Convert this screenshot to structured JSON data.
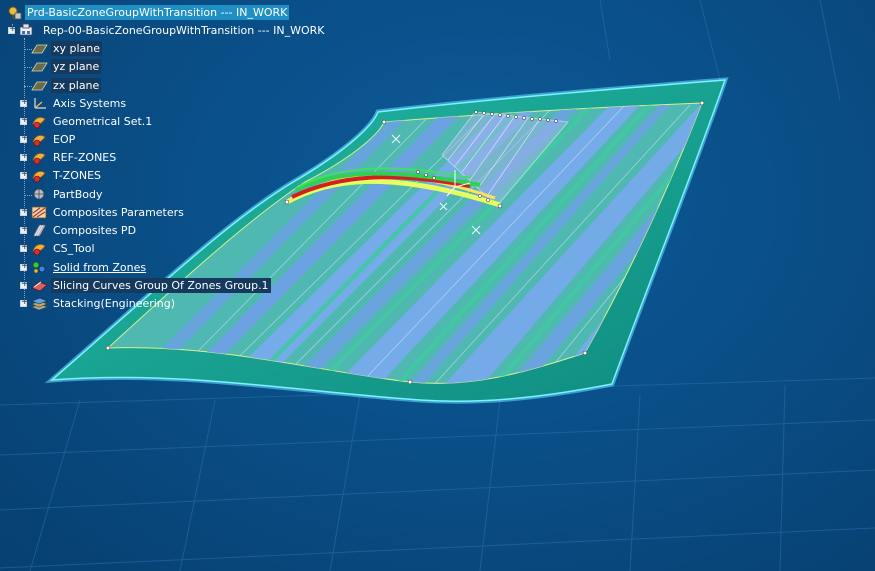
{
  "tree": {
    "root_label": "Prd-BasicZoneGroupWithTransition --- IN_WORK",
    "rep_label": "Rep-00-BasicZoneGroupWithTransition --- IN_WORK",
    "planes": [
      "xy plane",
      "yz plane",
      "zx plane"
    ],
    "items": [
      {
        "label": "Axis Systems",
        "icon": "axis-icon"
      },
      {
        "label": "Geometrical Set.1",
        "icon": "geometrical-set-icon"
      },
      {
        "label": "EOP",
        "icon": "geometrical-set-icon"
      },
      {
        "label": "REF-ZONES",
        "icon": "geometrical-set-icon"
      },
      {
        "label": "T-ZONES",
        "icon": "geometrical-set-icon"
      },
      {
        "label": "PartBody",
        "icon": "partbody-icon"
      },
      {
        "label": "Composites Parameters",
        "icon": "composites-parameters-icon"
      },
      {
        "label": "Composites PD",
        "icon": "composites-pd-icon"
      },
      {
        "label": "CS_Tool",
        "icon": "geometrical-set-icon"
      },
      {
        "label": "Solid from Zones",
        "icon": "solid-from-zones-icon"
      },
      {
        "label": "Slicing Curves Group Of Zones Group.1",
        "icon": "slicing-curves-icon"
      },
      {
        "label": "Stacking(Engineering)",
        "icon": "stacking-icon"
      }
    ]
  },
  "colors": {
    "background": "#0a4f88",
    "surface_teal": "#1aa89a",
    "zone_blue": "#6fa0e8",
    "zone_green": "#3fc9a0",
    "edge_cyan": "#5fe0ff",
    "selection_highlight": "#1f8fc4"
  }
}
